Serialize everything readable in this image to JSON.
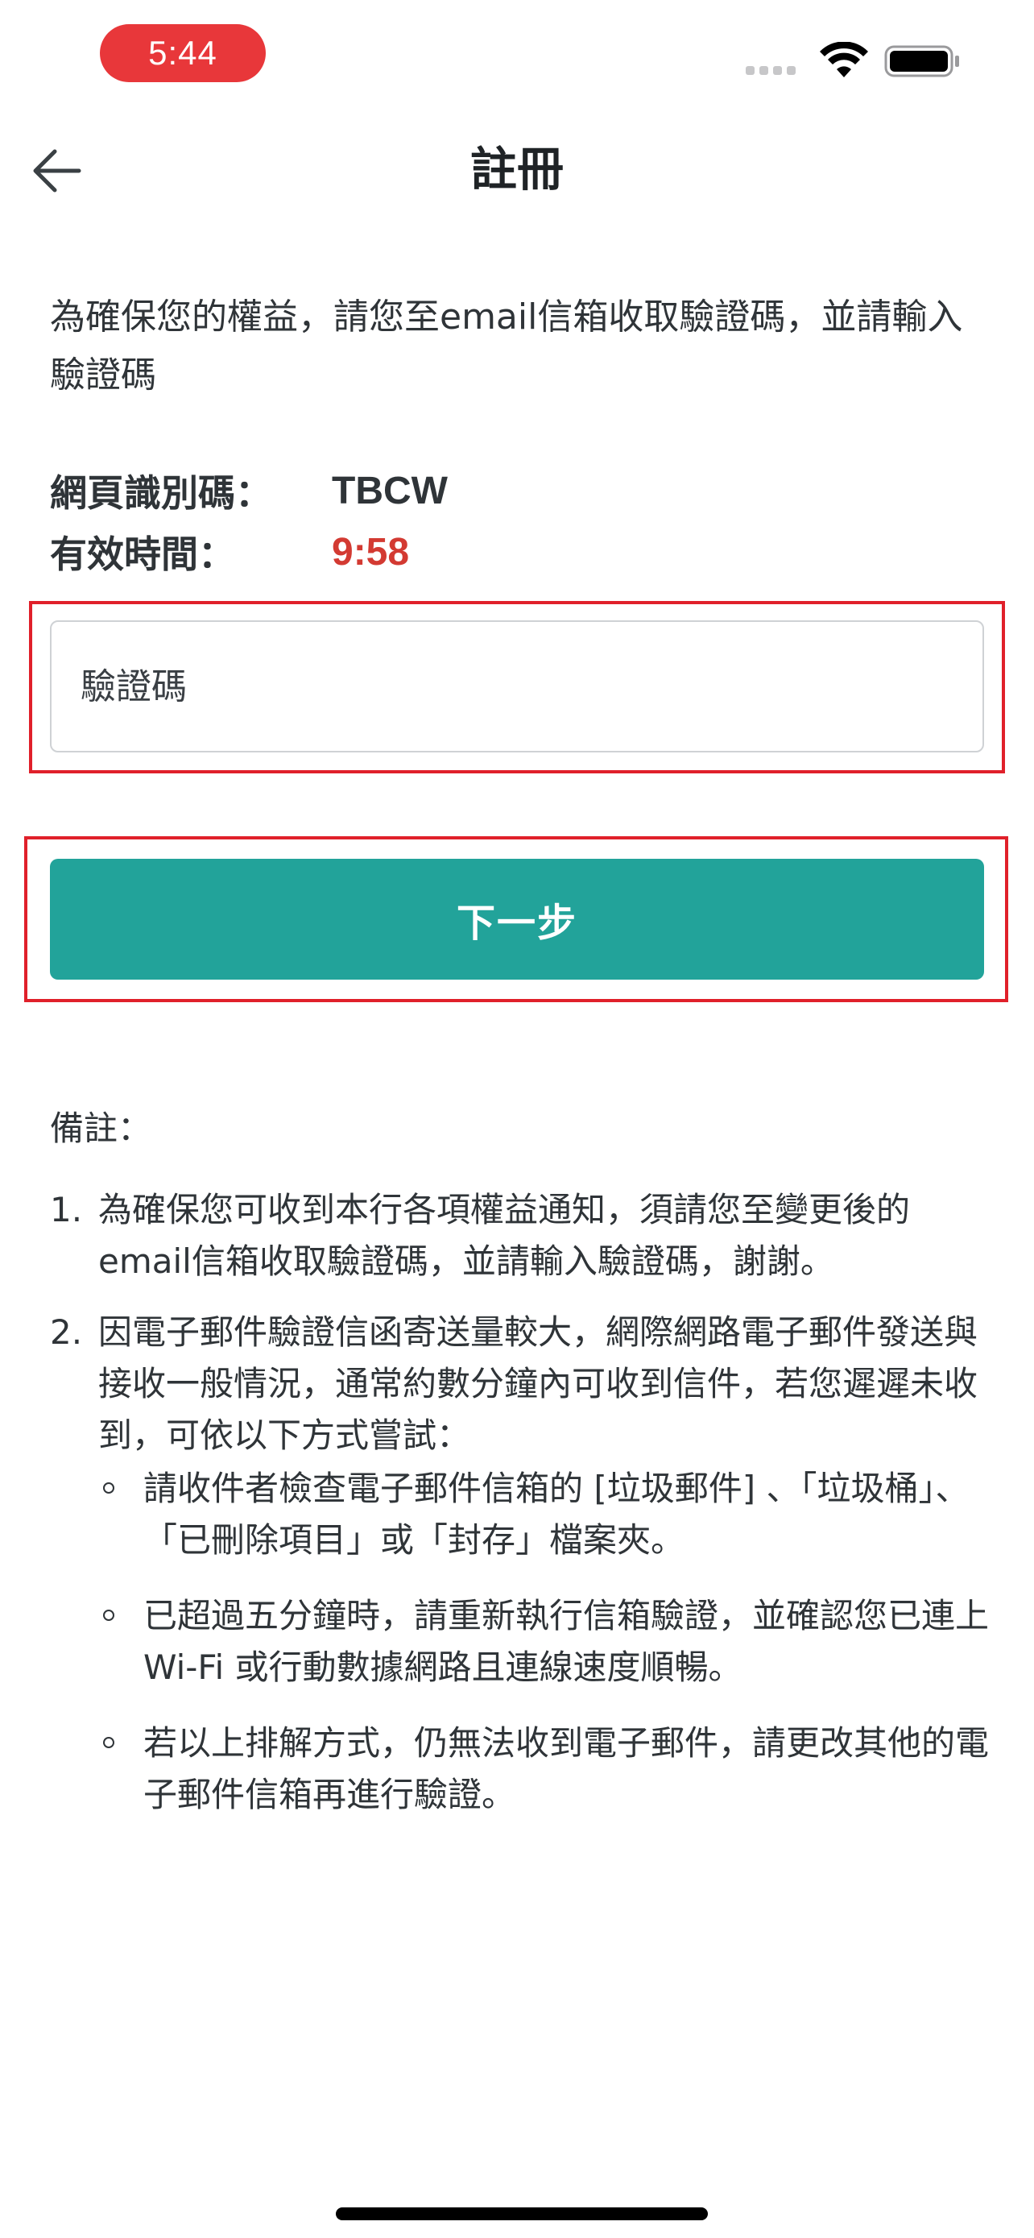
{
  "status_bar": {
    "time": "5:44"
  },
  "nav": {
    "title": "註冊"
  },
  "intro": {
    "text": "為確保您的權益，請您至email信箱收取驗證碼，並請輸入驗證碼"
  },
  "info": {
    "web_id_label": "網頁識別碼：",
    "web_id_value": "TBCW",
    "valid_time_label": "有效時間：",
    "valid_time_value": "9:58"
  },
  "form": {
    "code_placeholder": "驗證碼",
    "code_value": "",
    "next_label": "下一步"
  },
  "notes": {
    "title": "備註：",
    "items": [
      {
        "num": "1.",
        "text": "為確保您可收到本行各項權益通知，須請您至變更後的email信箱收取驗證碼，並請輸入驗證碼，謝謝。"
      },
      {
        "num": "2.",
        "text": "因電子郵件驗證信函寄送量較大，網際網路電子郵件發送與接收一般情況，通常約數分鐘內可收到信件，若您遲遲未收到，可依以下方式嘗試：",
        "subs": [
          "請收件者檢查電子郵件信箱的 [垃圾郵件] 、「垃圾桶」、「已刪除項目」或「封存」檔案夾。",
          "已超過五分鐘時，請重新執行信箱驗證，並確認您已連上Wi-Fi 或行動數據網路且連線速度順暢。",
          "若以上排解方式，仍無法收到電子郵件，請更改其他的電子郵件信箱再進行驗證。"
        ]
      }
    ]
  },
  "colors": {
    "accent": "#22a39a",
    "highlight": "#e0202a",
    "time_red": "#d33a32",
    "status_pill": "#e8373a"
  }
}
